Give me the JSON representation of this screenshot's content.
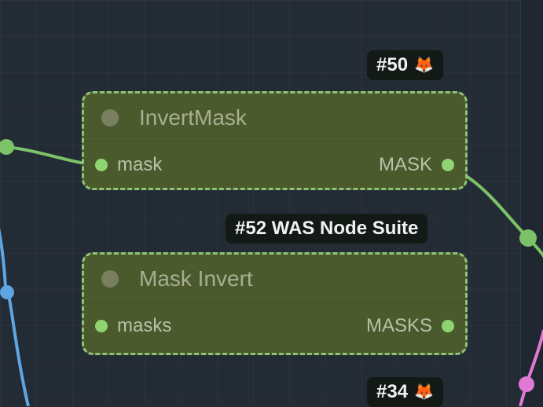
{
  "nodes": [
    {
      "badge": "#50",
      "badge_icon": "fox-icon",
      "title": "InvertMask",
      "input_label": "mask",
      "output_label": "MASK"
    },
    {
      "badge": "#52 WAS Node Suite",
      "title": "Mask Invert",
      "input_label": "masks",
      "output_label": "MASKS"
    },
    {
      "badge": "#34",
      "badge_icon": "fox-icon"
    }
  ],
  "colors": {
    "canvas": "#232b35",
    "node_body": "#4b5a2c",
    "node_border": "#8fc37a",
    "mask_wire": "#7cc269",
    "image_wire": "#5da6e3",
    "pink_wire": "#e07ad6"
  }
}
